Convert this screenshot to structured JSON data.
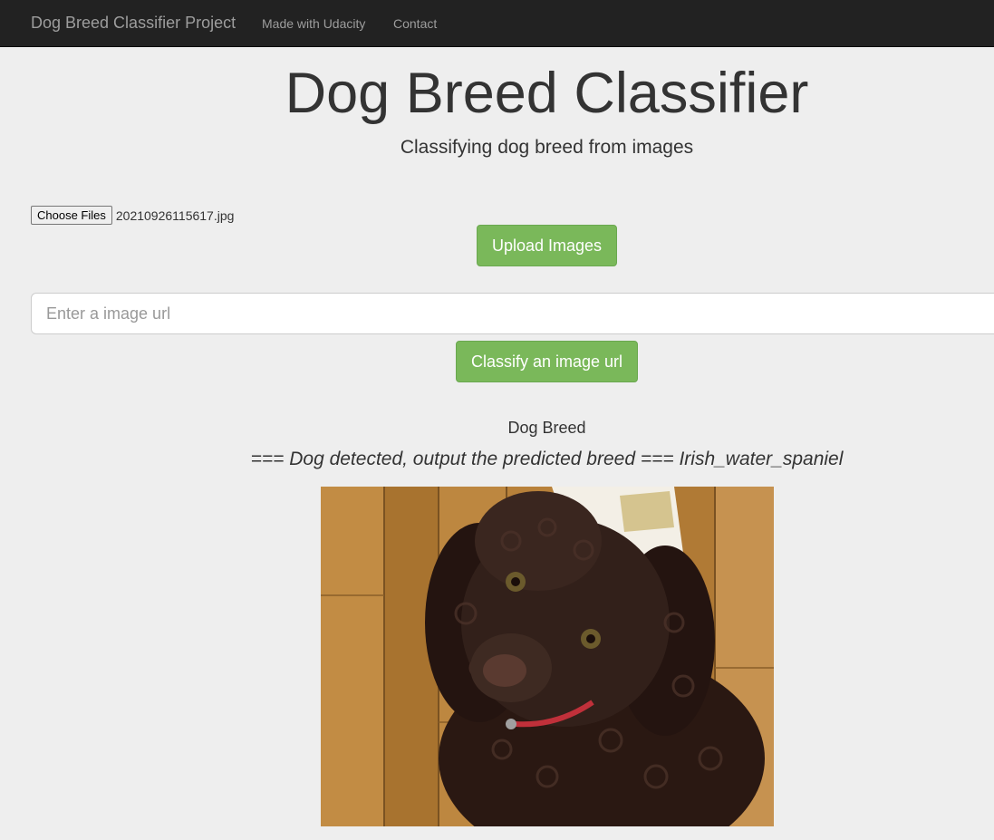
{
  "navbar": {
    "brand": "Dog Breed Classifier Project",
    "links": [
      "Made with Udacity",
      "Contact"
    ]
  },
  "header": {
    "title": "Dog Breed Classifier",
    "subtitle": "Classifying dog breed from images"
  },
  "upload": {
    "choose_label": "Choose Files",
    "file_name": "20210926115617.jpg",
    "upload_button": "Upload Images"
  },
  "url_form": {
    "placeholder": "Enter a image url",
    "classify_button": "Classify an image url"
  },
  "result": {
    "label": "Dog Breed",
    "text": "=== Dog detected, output the predicted breed === Irish_water_spaniel"
  },
  "colors": {
    "navbar_bg": "#222222",
    "page_bg": "#eeeeee",
    "button_green": "#7ab85a"
  }
}
